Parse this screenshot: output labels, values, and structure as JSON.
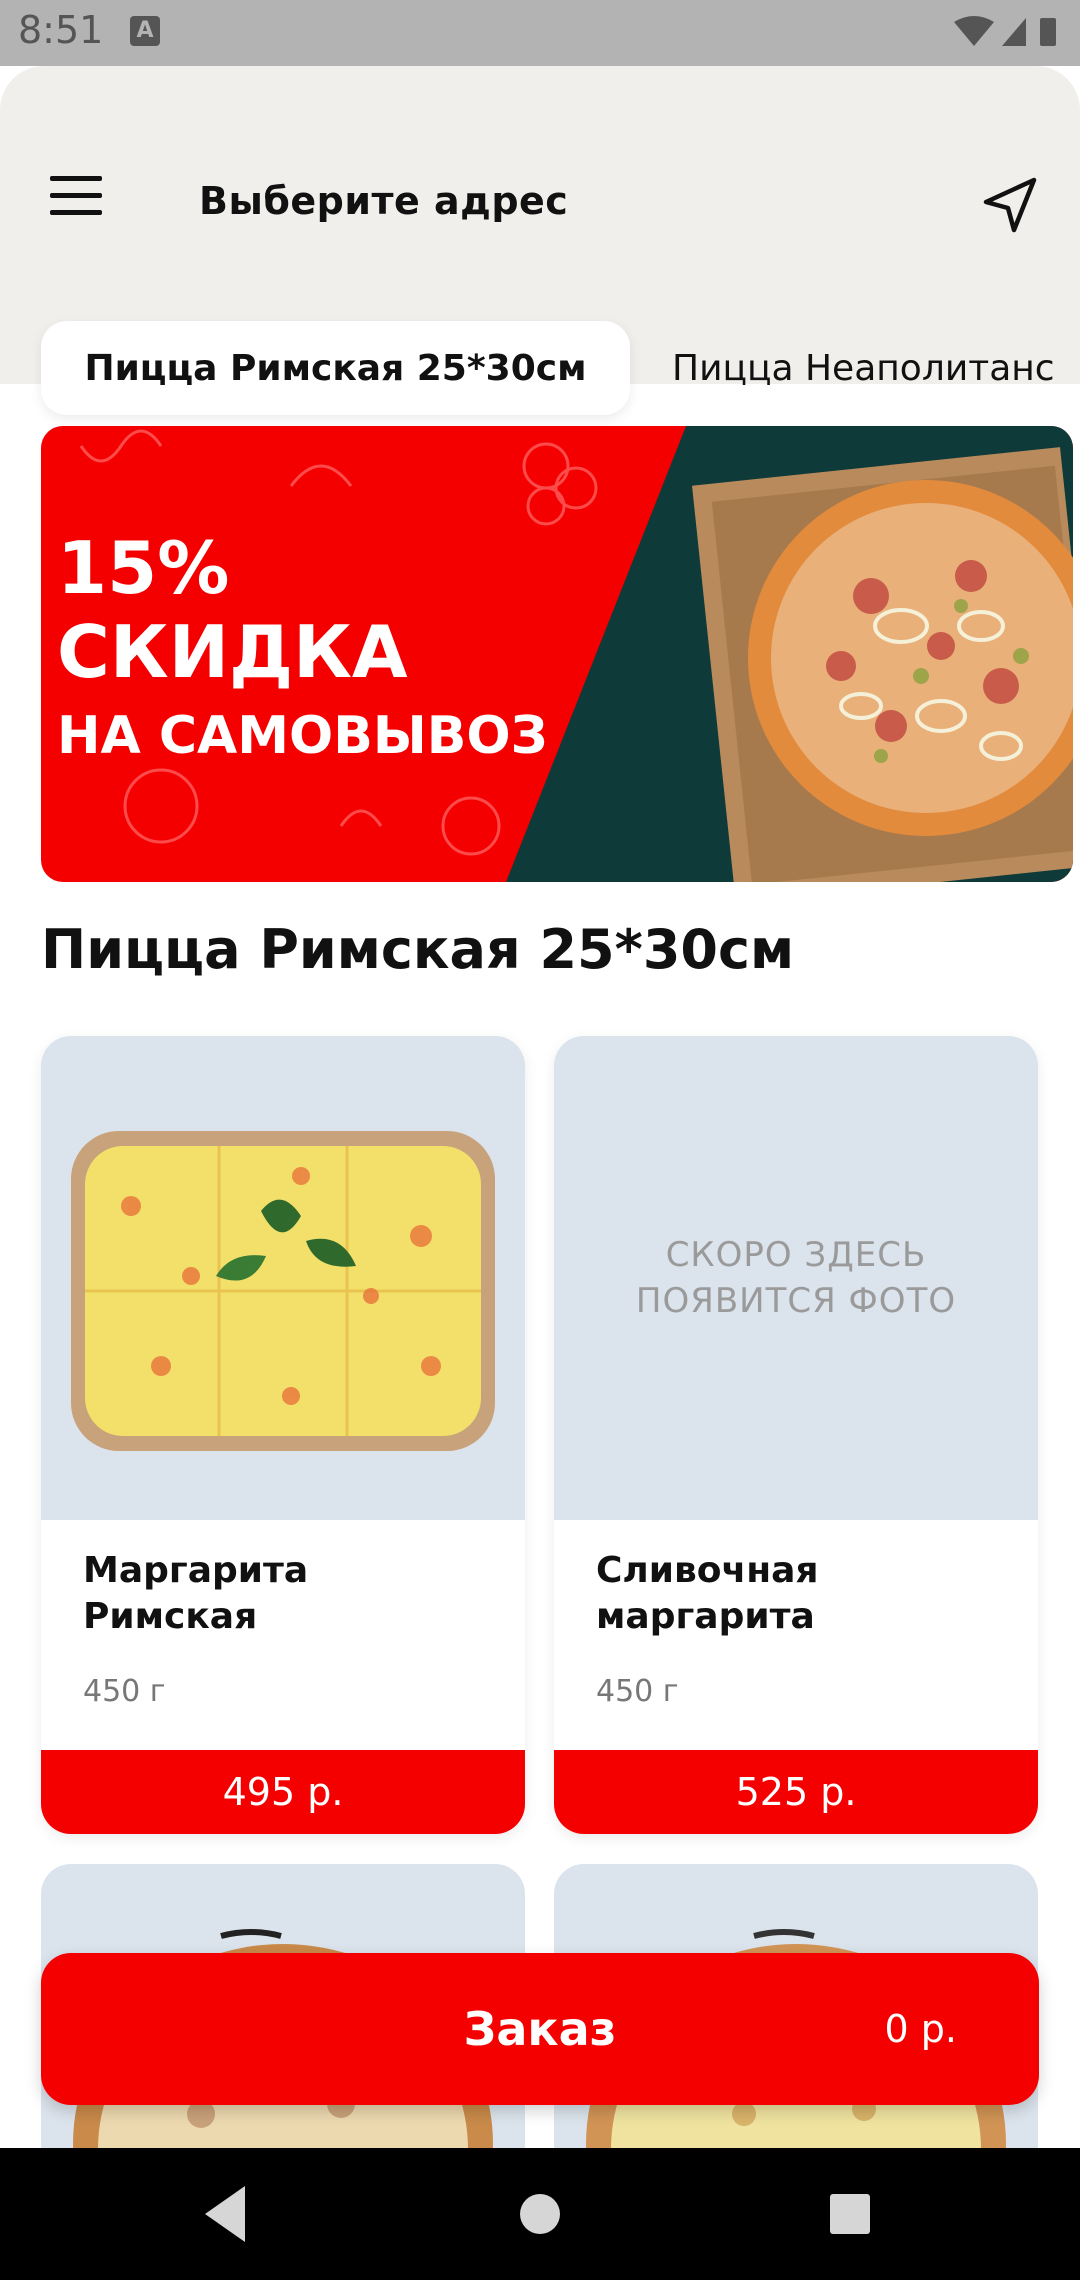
{
  "status_bar": {
    "time": "8:51",
    "notification_icon": "A"
  },
  "header": {
    "address_title": "Выберите адрес"
  },
  "categories": [
    {
      "label": "Пицца Римская 25*30см",
      "active": true
    },
    {
      "label": "Пицца Неаполитанс",
      "active": false
    }
  ],
  "promo": {
    "line1": "15%",
    "line2": "СКИДКА",
    "line3": "НА САМОВЫВОЗ"
  },
  "section": {
    "title": "Пицца Римская 25*30см"
  },
  "products": [
    {
      "name": "Маргарита Римская",
      "weight": "450 г",
      "price": "495 р.",
      "image": "pizza-photo"
    },
    {
      "name": "Сливочная маргарита",
      "weight": "450 г",
      "price": "525 р.",
      "image_placeholder": "СКОРО ЗДЕСЬ ПОЯВИТСЯ ФОТО"
    }
  ],
  "order": {
    "label": "Заказ",
    "total": "0 р."
  },
  "colors": {
    "accent": "#f50000",
    "background": "#f1efeb",
    "card_image_bg": "#dbe3ec"
  }
}
